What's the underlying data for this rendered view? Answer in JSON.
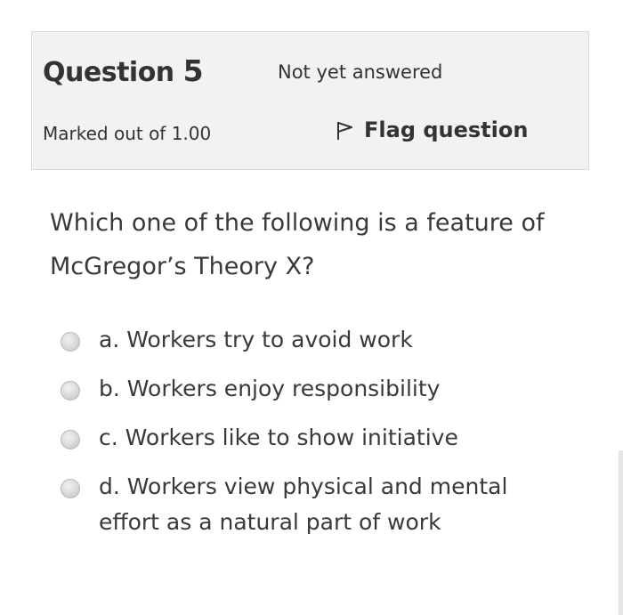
{
  "question_info": {
    "title_prefix": "Question ",
    "number": "5",
    "state": "Not yet answered",
    "grade": "Marked out of 1.00",
    "flag_label": "Flag question"
  },
  "question": {
    "line1": "Which one of the following is a feature of",
    "line2": "McGregor’s Theory X?"
  },
  "answers": [
    {
      "label": "a. Workers try to avoid work",
      "selected": false
    },
    {
      "label": "b. Workers enjoy responsibility",
      "selected": false
    },
    {
      "label": "c. Workers like to show initiative",
      "selected": false
    },
    {
      "label_line1": "d. Workers view physical and mental",
      "label_line2": "effort as a natural part of work",
      "selected": false
    }
  ],
  "icons": {
    "flag": "flag-icon",
    "radio": "radio-button"
  }
}
